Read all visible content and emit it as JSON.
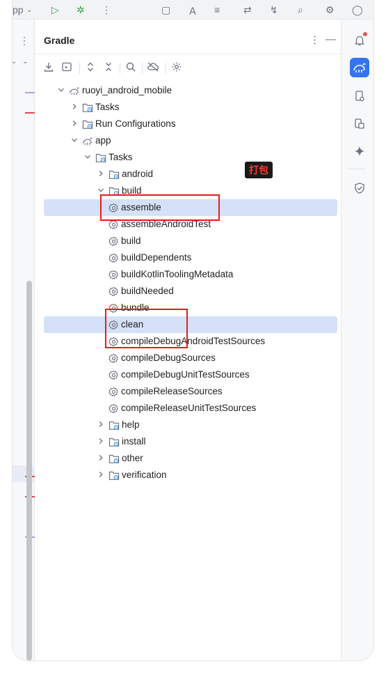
{
  "topbar": {
    "app_label": "pp"
  },
  "panel": {
    "title": "Gradle"
  },
  "tree": [
    {
      "label": "ruoyi_android_mobile",
      "icon": "gradle-project-icon",
      "expanded": true
    },
    {
      "label": "Tasks",
      "icon": "folder-gear-icon",
      "expanded": false
    },
    {
      "label": "Run Configurations",
      "icon": "folder-gear-icon",
      "expanded": false
    },
    {
      "label": "app",
      "icon": "gradle-project-icon",
      "expanded": true
    },
    {
      "label": "Tasks",
      "icon": "folder-gear-icon",
      "expanded": true
    },
    {
      "label": "android",
      "icon": "folder-gear-icon",
      "expanded": false
    },
    {
      "label": "build",
      "icon": "folder-gear-icon",
      "expanded": true
    },
    {
      "label": "assemble",
      "icon": "gear-icon",
      "selected": true
    },
    {
      "label": "assembleAndroidTest",
      "icon": "gear-icon"
    },
    {
      "label": "build",
      "icon": "gear-icon"
    },
    {
      "label": "buildDependents",
      "icon": "gear-icon"
    },
    {
      "label": "buildKotlinToolingMetadata",
      "icon": "gear-icon"
    },
    {
      "label": "buildNeeded",
      "icon": "gear-icon"
    },
    {
      "label": "bundle",
      "icon": "gear-icon"
    },
    {
      "label": "clean",
      "icon": "gear-icon",
      "selected": true
    },
    {
      "label": "compileDebugAndroidTestSources",
      "icon": "gear-icon"
    },
    {
      "label": "compileDebugSources",
      "icon": "gear-icon"
    },
    {
      "label": "compileDebugUnitTestSources",
      "icon": "gear-icon"
    },
    {
      "label": "compileReleaseSources",
      "icon": "gear-icon"
    },
    {
      "label": "compileReleaseUnitTestSources",
      "icon": "gear-icon"
    },
    {
      "label": "help",
      "icon": "folder-gear-icon",
      "expanded": false
    },
    {
      "label": "install",
      "icon": "folder-gear-icon",
      "expanded": false
    },
    {
      "label": "other",
      "icon": "folder-gear-icon",
      "expanded": false
    },
    {
      "label": "verification",
      "icon": "folder-gear-icon",
      "expanded": false
    }
  ],
  "annotation": {
    "text": "打包"
  },
  "colors": {
    "accent": "#3574f0",
    "selection": "#d5e1f7",
    "annotation_red": "#e51c1c"
  }
}
